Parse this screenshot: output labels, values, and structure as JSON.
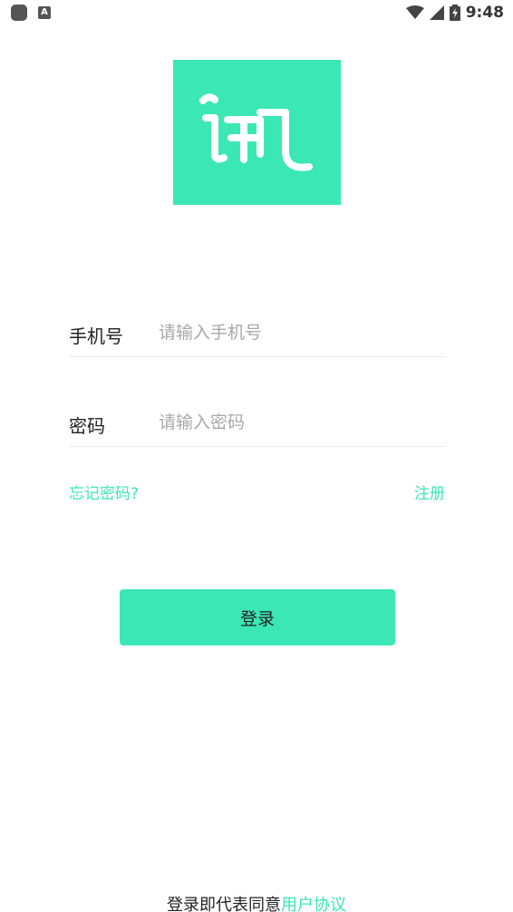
{
  "status_bar": {
    "time": "9:48",
    "left_icons": [
      "app-circle-icon",
      "a-badge-icon"
    ],
    "right_icons": [
      "wifi-icon",
      "cell-signal-icon",
      "battery-charging-icon"
    ]
  },
  "brand": {
    "logo_glyph": "讯",
    "logo_color": "#3be8b5"
  },
  "form": {
    "phone": {
      "label": "手机号",
      "placeholder": "请输入手机号",
      "value": ""
    },
    "password": {
      "label": "密码",
      "placeholder": "请输入密码",
      "value": ""
    },
    "forgot_link": "忘记密码?",
    "register_link": "注册",
    "login_button": "登录"
  },
  "footer": {
    "agreement_prefix": "登录即代表同意",
    "agreement_link": "用户协议"
  },
  "colors": {
    "accent": "#3be8b5",
    "text": "#222222",
    "placeholder": "#a8a8a8",
    "divider": "#ececec"
  }
}
